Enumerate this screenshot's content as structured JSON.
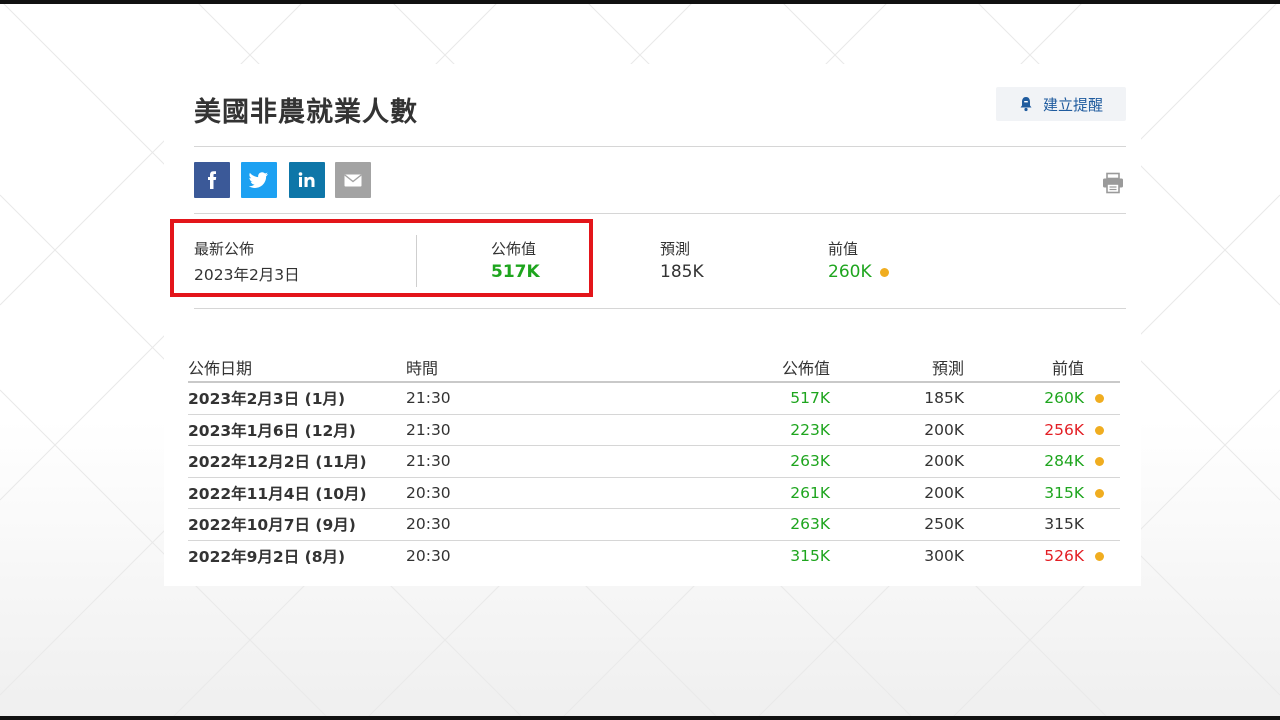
{
  "title": "美國非農就業人數",
  "alert_button": {
    "label": "建立提醒",
    "icon": "bell-icon"
  },
  "share": [
    {
      "name": "facebook",
      "glyph": "f"
    },
    {
      "name": "twitter",
      "glyph": "twitter-bird"
    },
    {
      "name": "linkedin",
      "glyph": "in"
    },
    {
      "name": "email",
      "glyph": "envelope"
    }
  ],
  "summary": {
    "latest_label": "最新公佈",
    "latest_date": "2023年2月3日",
    "actual_label": "公佈值",
    "actual_value": "517K",
    "forecast_label": "預測",
    "forecast_value": "185K",
    "previous_label": "前值",
    "previous_value": "260K"
  },
  "history": {
    "headers": {
      "date": "公佈日期",
      "time": "時間",
      "actual": "公佈值",
      "forecast": "預測",
      "previous": "前值"
    },
    "rows": [
      {
        "date": "2023年2月3日 (1月)",
        "time": "21:30",
        "actual": "517K",
        "forecast": "185K",
        "previous": "260K",
        "previous_color": "green",
        "revised": true
      },
      {
        "date": "2023年1月6日 (12月)",
        "time": "21:30",
        "actual": "223K",
        "forecast": "200K",
        "previous": "256K",
        "previous_color": "red",
        "revised": true
      },
      {
        "date": "2022年12月2日 (11月)",
        "time": "21:30",
        "actual": "263K",
        "forecast": "200K",
        "previous": "284K",
        "previous_color": "green",
        "revised": true
      },
      {
        "date": "2022年11月4日 (10月)",
        "time": "20:30",
        "actual": "261K",
        "forecast": "200K",
        "previous": "315K",
        "previous_color": "green",
        "revised": true
      },
      {
        "date": "2022年10月7日 (9月)",
        "time": "20:30",
        "actual": "263K",
        "forecast": "250K",
        "previous": "315K",
        "previous_color": "dark",
        "revised": false
      },
      {
        "date": "2022年9月2日 (8月)",
        "time": "20:30",
        "actual": "315K",
        "forecast": "300K",
        "previous": "526K",
        "previous_color": "red",
        "revised": true
      }
    ]
  },
  "colors": {
    "positive": "#1ea51e",
    "negative": "#e31e24",
    "revised_dot": "#f0ad20",
    "highlight": "#e3151a",
    "link": "#1f5b9e"
  }
}
